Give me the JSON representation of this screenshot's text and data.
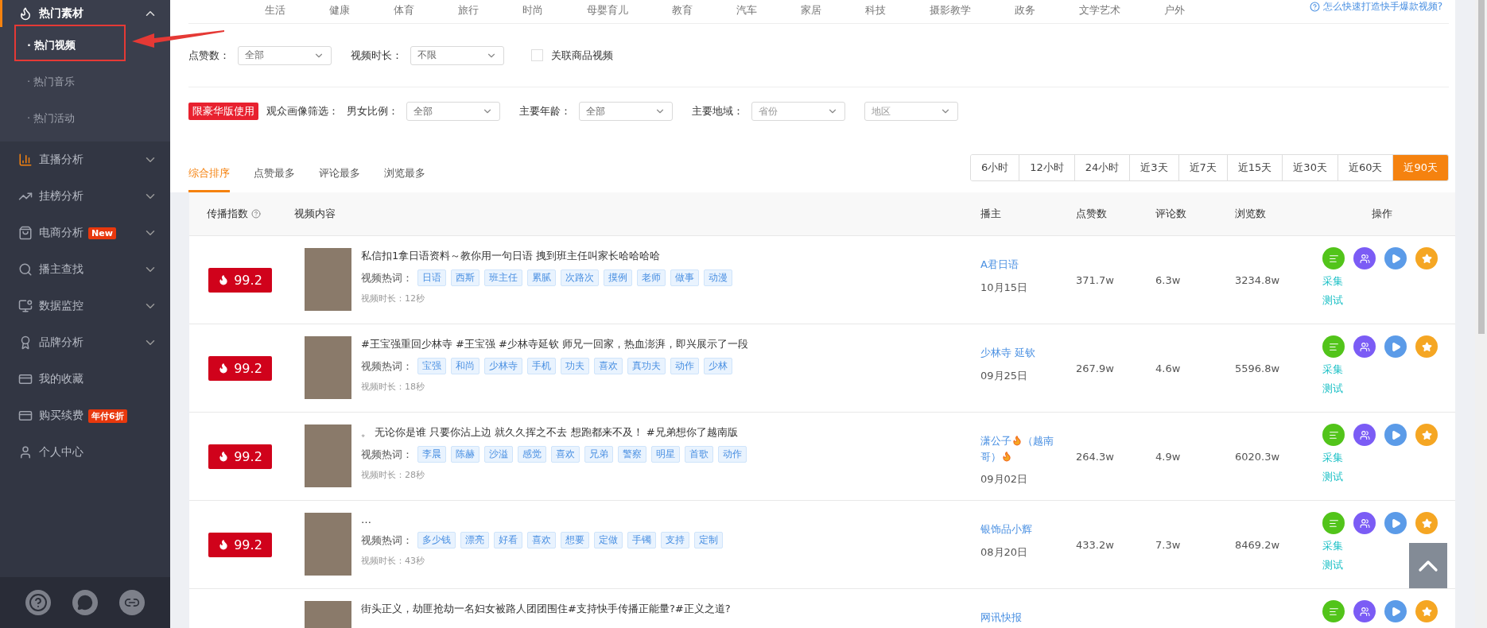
{
  "sidebar": {
    "items": [
      {
        "label": "热门素材",
        "expanded": true,
        "selected": true,
        "children": [
          {
            "label": "· 热门视频",
            "selected": true,
            "annotated": true
          },
          {
            "label": "· 热门音乐",
            "selected": false,
            "annotated": false
          },
          {
            "label": "· 热门活动",
            "selected": false,
            "annotated": false
          }
        ]
      },
      {
        "label": "直播分析",
        "expanded": false,
        "selected": false
      },
      {
        "label": "挂榜分析",
        "expanded": false,
        "selected": false
      },
      {
        "label": "电商分析",
        "expanded": false,
        "selected": false,
        "badge": "New"
      },
      {
        "label": "播主查找",
        "expanded": false,
        "selected": false
      },
      {
        "label": "数据监控",
        "expanded": false,
        "selected": false
      },
      {
        "label": "品牌分析",
        "expanded": false,
        "selected": false
      },
      {
        "label": "我的收藏",
        "selected": false
      },
      {
        "label": "购买续费",
        "selected": false,
        "badge": "年付6折"
      },
      {
        "label": "个人中心",
        "selected": false
      }
    ]
  },
  "categories": [
    "生活",
    "健康",
    "体育",
    "旅行",
    "时尚",
    "母婴育儿",
    "教育",
    "汽车",
    "家居",
    "科技",
    "摄影教学",
    "政务",
    "文学艺术",
    "户外"
  ],
  "help_link": "怎么快速打造快手爆款视频?",
  "filters": [
    {
      "label": "点赞数：",
      "value": "全部"
    },
    {
      "label": "视频时长：",
      "value": "不限"
    }
  ],
  "goods_checkbox": {
    "label": "关联商品视频",
    "checked": false
  },
  "premium_badge": "限豪华版使用",
  "audience_label": "观众画像筛选：",
  "audience_filters": [
    {
      "label": "男女比例：",
      "value": "全部"
    },
    {
      "label": "主要年龄：",
      "value": "全部"
    },
    {
      "label": "主要地域：",
      "placeholder": "省份"
    },
    {
      "placeholder": "地区"
    }
  ],
  "sort_tabs": [
    {
      "label": "综合排序",
      "selected": true
    },
    {
      "label": "点赞最多",
      "selected": false
    },
    {
      "label": "评论最多",
      "selected": false
    },
    {
      "label": "浏览最多",
      "selected": false
    }
  ],
  "time_ranges": [
    {
      "label": "6小时",
      "selected": false
    },
    {
      "label": "12小时",
      "selected": false
    },
    {
      "label": "24小时",
      "selected": false
    },
    {
      "label": "近3天",
      "selected": false
    },
    {
      "label": "近7天",
      "selected": false
    },
    {
      "label": "近15天",
      "selected": false
    },
    {
      "label": "近30天",
      "selected": false
    },
    {
      "label": "近60天",
      "selected": false
    },
    {
      "label": "近90天",
      "selected": true
    }
  ],
  "table": {
    "columns": [
      "传播指数",
      "视频内容",
      "播主",
      "点赞数",
      "评论数",
      "浏览数",
      "操作"
    ],
    "rows": [
      {
        "score": "99.2",
        "tags_label": "视频热词：",
        "actions": [
          "采集",
          "测试"
        ],
        "title": "私信扣1拿日语资料～教你用一句日语 拽到班主任叫家长哈哈哈哈",
        "tags": [
          "日语",
          "西斯",
          "班主任",
          "累腻",
          "次路次",
          "摸例",
          "老师",
          "做事",
          "动漫"
        ],
        "duration": "视频时长：12秒",
        "author": [
          {
            "kind": "text",
            "text": "A君日语"
          }
        ],
        "date": "10月15日",
        "likes": "371.7w",
        "comments": "6.3w",
        "views": "3234.8w"
      },
      {
        "score": "99.2",
        "tags_label": "视频热词：",
        "actions": [
          "采集",
          "测试"
        ],
        "title": "#王宝强重回少林寺 #王宝强 #少林寺延钦 师兄一回家，热血澎湃，即兴展示了一段",
        "tags": [
          "宝强",
          "和尚",
          "少林寺",
          "手机",
          "功夫",
          "喜欢",
          "真功夫",
          "动作",
          "少林"
        ],
        "duration": "视频时长：18秒",
        "author": [
          {
            "kind": "text",
            "text": "少林寺 延钦"
          }
        ],
        "date": "09月25日",
        "likes": "267.9w",
        "comments": "4.6w",
        "views": "5596.8w"
      },
      {
        "score": "99.2",
        "tags_label": "视频热词：",
        "actions": [
          "采集",
          "测试"
        ],
        "title": "。 无论你是谁 只要你沾上边 就久久挥之不去 想跑都来不及！ #兄弟想你了越南版",
        "tags": [
          "李晨",
          "陈赫",
          "沙溢",
          "感觉",
          "喜欢",
          "兄弟",
          "警察",
          "明星",
          "首歌",
          "动作"
        ],
        "duration": "视频时长：28秒",
        "author": [
          {
            "kind": "text",
            "text": "潇公子"
          },
          {
            "kind": "fire"
          },
          {
            "kind": "text",
            "text": "（越南哥）"
          },
          {
            "kind": "fire"
          }
        ],
        "date": "09月02日",
        "likes": "264.3w",
        "comments": "4.9w",
        "views": "6020.3w"
      },
      {
        "score": "99.2",
        "tags_label": "视频热词：",
        "actions": [
          "采集",
          "测试"
        ],
        "title": "…",
        "tags": [
          "多少钱",
          "漂亮",
          "好看",
          "喜欢",
          "想要",
          "定做",
          "手镯",
          "支持",
          "定制"
        ],
        "duration": "视频时长：43秒",
        "author": [
          {
            "kind": "text",
            "text": "银饰品小辉"
          }
        ],
        "date": "08月20日",
        "likes": "433.2w",
        "comments": "7.3w",
        "views": "8469.2w"
      },
      {
        "title": "街头正义，劫匪抢劫一名妇女被路人团团围住#支持快手传播正能量?#正义之道?",
        "author": [
          {
            "kind": "text",
            "text": "网讯快报"
          }
        ]
      }
    ]
  }
}
